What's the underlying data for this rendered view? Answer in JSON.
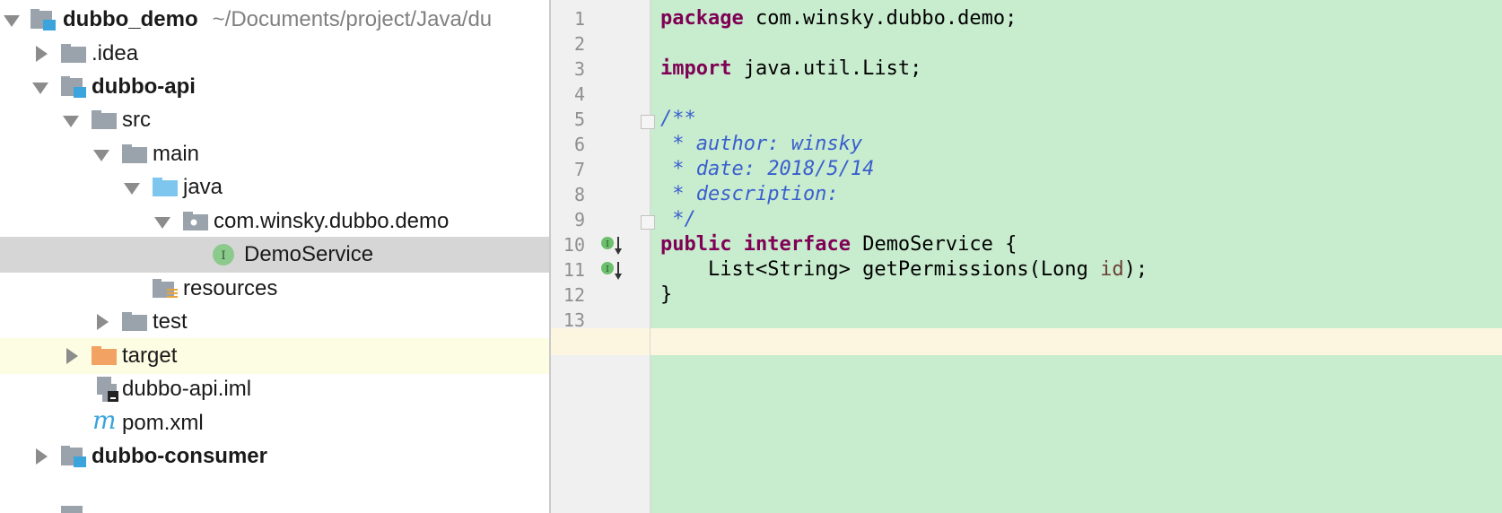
{
  "project_tree": {
    "rows": [
      {
        "label": "dubbo_demo",
        "path": "~/Documents/project/Java/du"
      },
      {
        "label": ".idea"
      },
      {
        "label": "dubbo-api"
      },
      {
        "label": "src"
      },
      {
        "label": "main"
      },
      {
        "label": "java"
      },
      {
        "label": "com.winsky.dubbo.demo"
      },
      {
        "label": "DemoService"
      },
      {
        "label": "resources"
      },
      {
        "label": "test"
      },
      {
        "label": "target"
      },
      {
        "label": "dubbo-api.iml"
      },
      {
        "label": "pom.xml"
      },
      {
        "label": "dubbo-consumer"
      }
    ]
  },
  "editor": {
    "line_numbers": [
      "1",
      "2",
      "3",
      "4",
      "5",
      "6",
      "7",
      "8",
      "9",
      "10",
      "11",
      "12",
      "13"
    ],
    "lines": {
      "l1_kw": "package",
      "l1_rest": " com.winsky.dubbo.demo;",
      "l3_kw": "import",
      "l3_rest": " java.util.List;",
      "l5": "/**",
      "l6": " * author: winsky",
      "l7": " * date: 2018/5/14",
      "l8": " * description:",
      "l9": " */",
      "l10_kw1": "public",
      "l10_kw2": "interface",
      "l10_rest": " DemoService {",
      "l11_a": "    List<String> getPermissions(Long ",
      "l11_param": "id",
      "l11_b": ");",
      "l12": "}"
    }
  },
  "colors": {
    "selection": "#d6d6d6",
    "code_background": "#c8ecce",
    "keyword": "#7f0055",
    "comment": "#3a5fcd",
    "current_line": "#fcf6e1"
  }
}
